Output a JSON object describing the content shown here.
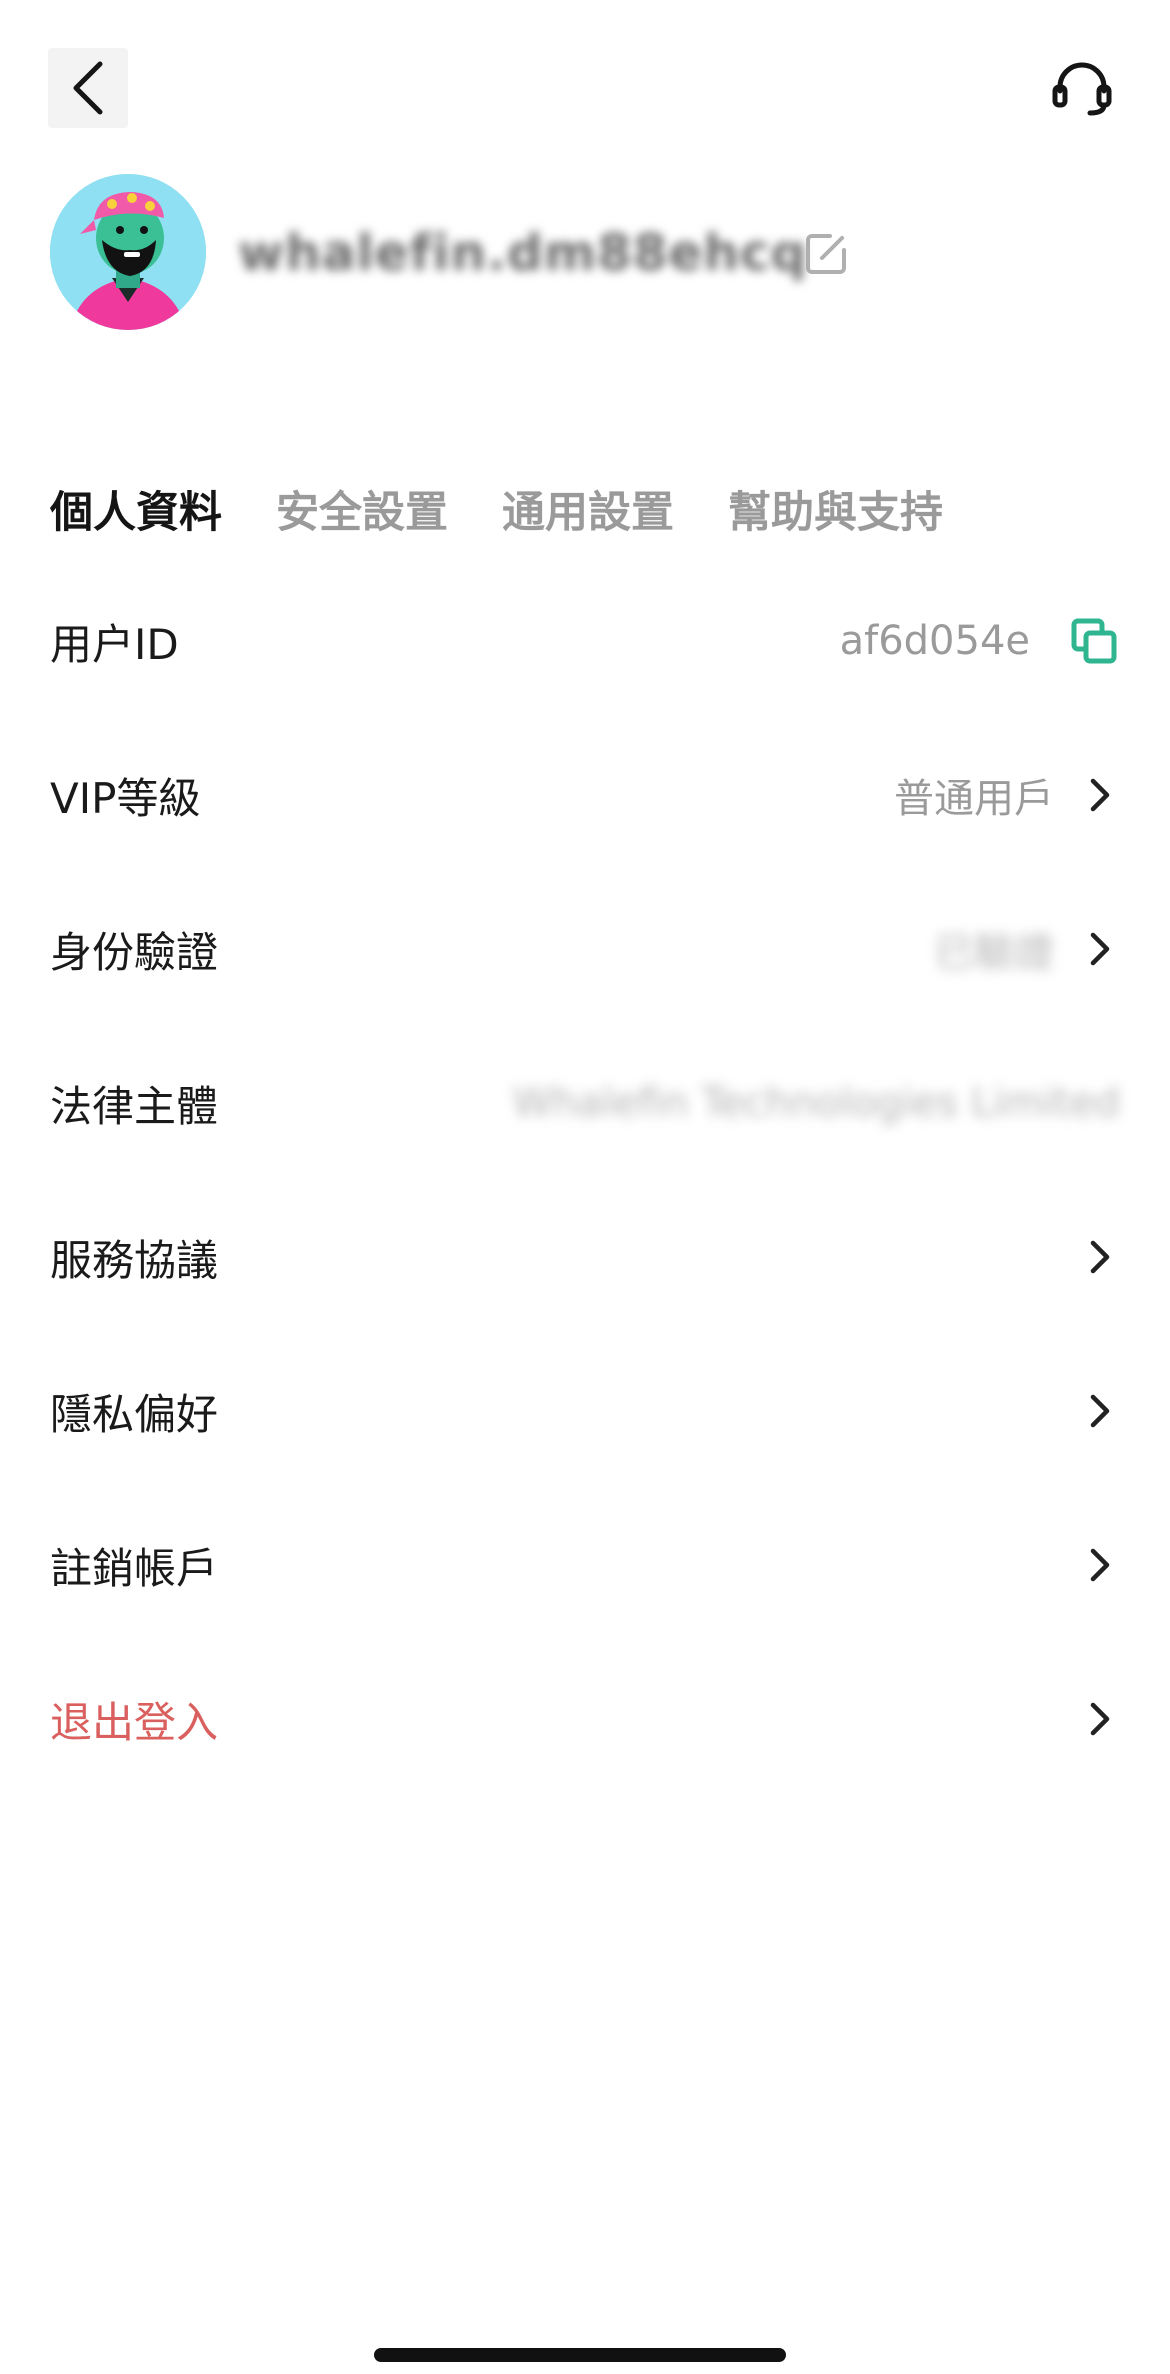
{
  "header": {
    "back_icon": "chevron-left-icon",
    "support_icon": "headset-icon"
  },
  "profile": {
    "username": "whalefin.dm88ehcq",
    "edit_icon": "edit-icon"
  },
  "tabs": [
    {
      "label": "個人資料",
      "active": true
    },
    {
      "label": "安全設置",
      "active": false
    },
    {
      "label": "通用設置",
      "active": false
    },
    {
      "label": "幫助與支持",
      "active": false
    }
  ],
  "rows": {
    "user_id": {
      "label": "用户ID",
      "value": "af6d054e",
      "icon": "copy-icon"
    },
    "vip": {
      "label": "VIP等級",
      "value": "普通用戶"
    },
    "identity": {
      "label": "身份驗證",
      "value": "已驗證"
    },
    "legal": {
      "label": "法律主體",
      "value": "Whalefin Technologies Limited"
    },
    "agreement": {
      "label": "服務協議"
    },
    "privacy": {
      "label": "隱私偏好"
    },
    "cancel_account": {
      "label": "註銷帳戶"
    },
    "logout": {
      "label": "退出登入"
    }
  },
  "colors": {
    "accent_green": "#2fb58f",
    "danger_red": "#d9605e",
    "muted_text": "#9a9a9a"
  }
}
